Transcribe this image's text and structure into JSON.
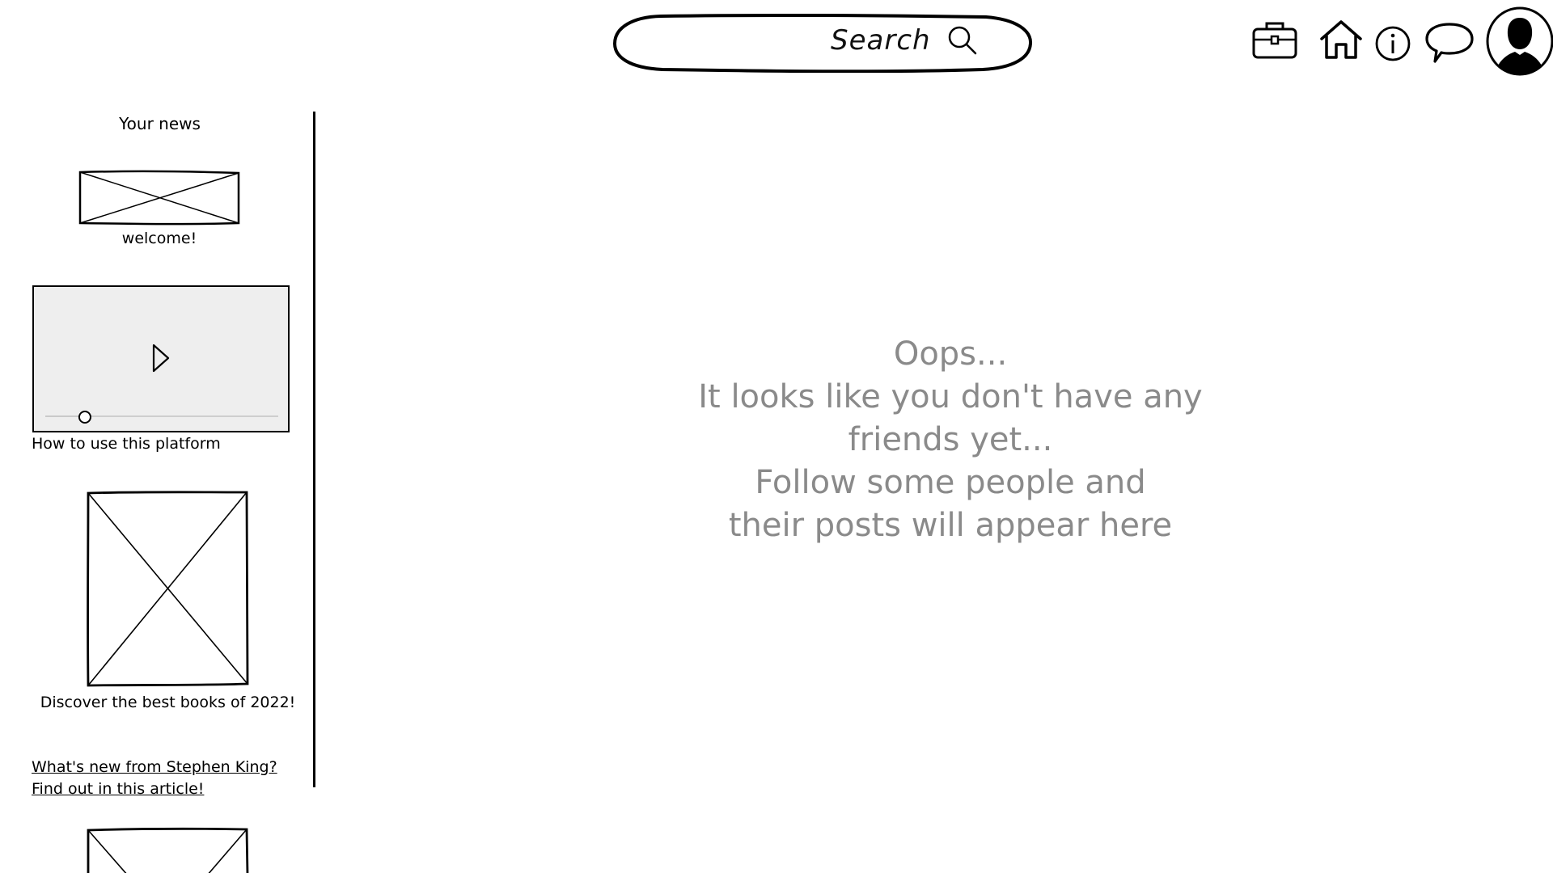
{
  "header": {
    "search": {
      "label": "Search",
      "icon": "search-icon"
    },
    "icons": [
      "briefcase-icon",
      "home-icon",
      "info-icon",
      "chat-bubble-icon",
      "avatar"
    ]
  },
  "sidebar": {
    "title": "Your news",
    "items": [
      {
        "type": "image",
        "caption": "welcome!"
      },
      {
        "type": "video",
        "caption": "How to use this platform",
        "progress": 0.17
      },
      {
        "type": "image",
        "caption": "Discover the best books of 2022!"
      },
      {
        "type": "link",
        "caption": "What's new from Stephen King? Find out in this article!"
      },
      {
        "type": "image",
        "caption": ""
      }
    ]
  },
  "main": {
    "empty_message": [
      "Oops...",
      "It looks like you don't have any",
      "friends yet...",
      "Follow some people and",
      "their posts will appear here"
    ]
  },
  "colors": {
    "text": "#000000",
    "muted": "#8a8a8a",
    "video_bg": "#eeeeee"
  }
}
